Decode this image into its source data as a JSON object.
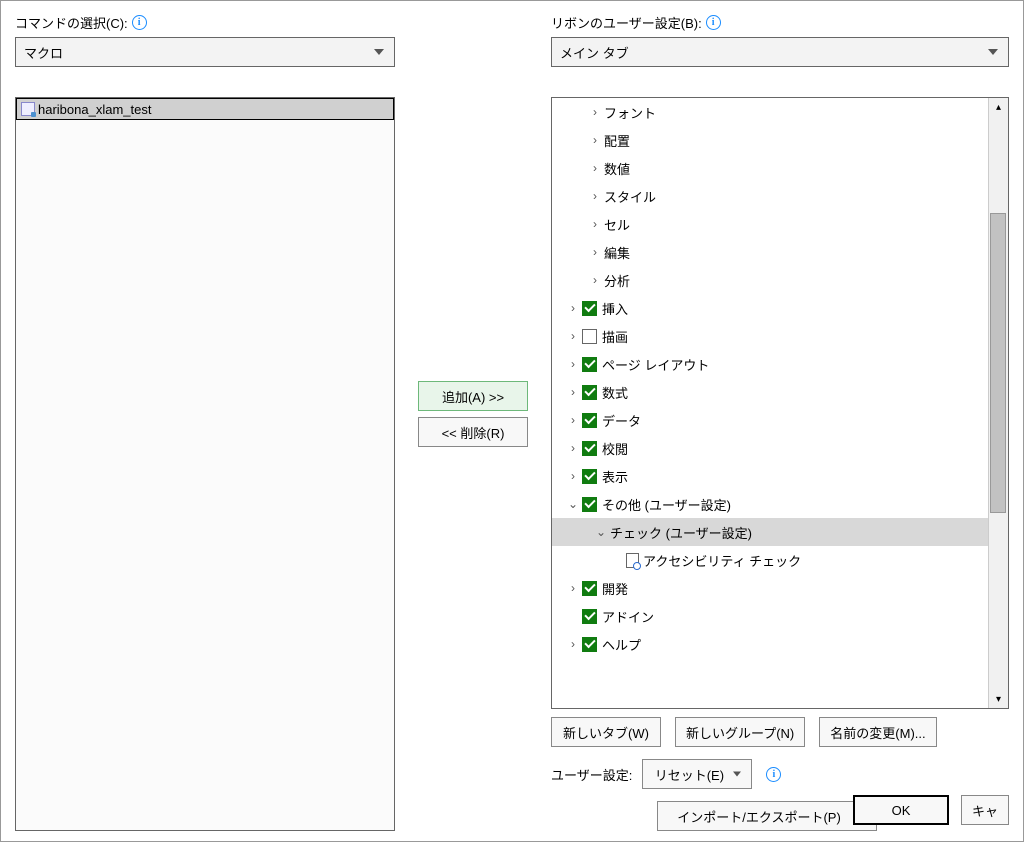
{
  "left": {
    "label": "コマンドの選択(C):",
    "dropdown": "マクロ",
    "commands": [
      {
        "label": "haribona_xlam_test",
        "selected": true
      }
    ]
  },
  "middle": {
    "add": "追加(A) >>",
    "remove": "<< 削除(R)"
  },
  "right": {
    "label": "リボンのユーザー設定(B):",
    "dropdown": "メイン タブ",
    "tree": [
      {
        "level": 2,
        "expand": ">",
        "label": "フォント"
      },
      {
        "level": 2,
        "expand": ">",
        "label": "配置"
      },
      {
        "level": 2,
        "expand": ">",
        "label": "数値"
      },
      {
        "level": 2,
        "expand": ">",
        "label": "スタイル"
      },
      {
        "level": 2,
        "expand": ">",
        "label": "セル"
      },
      {
        "level": 2,
        "expand": ">",
        "label": "編集"
      },
      {
        "level": 2,
        "expand": ">",
        "label": "分析"
      },
      {
        "level": 1,
        "expand": ">",
        "checked": true,
        "label": "挿入"
      },
      {
        "level": 1,
        "expand": ">",
        "checked": false,
        "label": "描画"
      },
      {
        "level": 1,
        "expand": ">",
        "checked": true,
        "label": "ページ レイアウト"
      },
      {
        "level": 1,
        "expand": ">",
        "checked": true,
        "label": "数式"
      },
      {
        "level": 1,
        "expand": ">",
        "checked": true,
        "label": "データ"
      },
      {
        "level": 1,
        "expand": ">",
        "checked": true,
        "label": "校閲"
      },
      {
        "level": 1,
        "expand": ">",
        "checked": true,
        "label": "表示"
      },
      {
        "level": 1,
        "expand": "v",
        "checked": true,
        "label": "その他 (ユーザー設定)"
      },
      {
        "level": 3,
        "expand": "v",
        "label": "チェック (ユーザー設定)",
        "selected": true
      },
      {
        "level": 4,
        "icon": "doc",
        "label": "アクセシビリティ チェック"
      },
      {
        "level": 1,
        "expand": ">",
        "checked": true,
        "label": "開発"
      },
      {
        "level": 1,
        "expand": "",
        "checked": true,
        "label": "アドイン"
      },
      {
        "level": 1,
        "expand": ">",
        "checked": true,
        "label": "ヘルプ"
      }
    ],
    "buttons": {
      "newTab": "新しいタブ(W)",
      "newGroup": "新しいグループ(N)",
      "rename": "名前の変更(M)..."
    },
    "userSettingsLabel": "ユーザー設定:",
    "reset": "リセット(E)",
    "importExport": "インポート/エクスポート(P)"
  },
  "bottom": {
    "ok": "OK",
    "cancel": "キャ"
  }
}
